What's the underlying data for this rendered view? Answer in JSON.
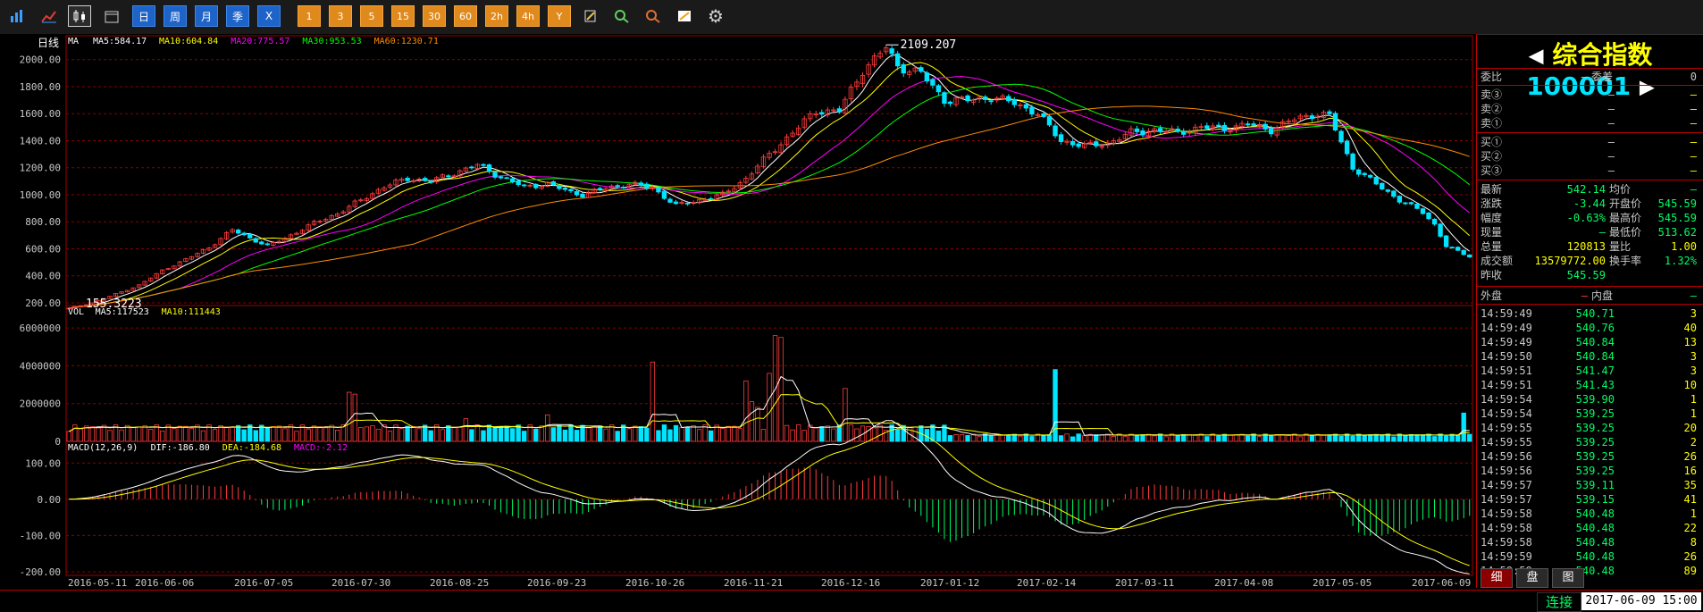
{
  "toolbar": {
    "buttons": [
      {
        "name": "bar-chart-icon",
        "text": "",
        "style": "icon"
      },
      {
        "name": "line-chart-icon",
        "text": "",
        "style": "icon"
      },
      {
        "name": "candlestick-icon",
        "text": "",
        "style": "active"
      },
      {
        "name": "calendar-icon",
        "text": "",
        "style": "icon"
      },
      {
        "name": "period-day-button",
        "text": "日",
        "style": "blue"
      },
      {
        "name": "period-week-button",
        "text": "周",
        "style": "blue"
      },
      {
        "name": "period-month-button",
        "text": "月",
        "style": "blue"
      },
      {
        "name": "period-quarter-button",
        "text": "季",
        "style": "blue"
      },
      {
        "name": "period-year-button",
        "text": "X",
        "style": "blue"
      },
      {
        "name": "period-1min-button",
        "text": "1",
        "style": "orange"
      },
      {
        "name": "period-3min-button",
        "text": "3",
        "style": "orange"
      },
      {
        "name": "period-5min-button",
        "text": "5",
        "style": "orange"
      },
      {
        "name": "period-15min-button",
        "text": "15",
        "style": "orange"
      },
      {
        "name": "period-30min-button",
        "text": "30",
        "style": "orange"
      },
      {
        "name": "period-60min-button",
        "text": "60",
        "style": "orange"
      },
      {
        "name": "period-2h-button",
        "text": "2h",
        "style": "orange"
      },
      {
        "name": "period-4h-button",
        "text": "4h",
        "style": "orange"
      },
      {
        "name": "period-y-button",
        "text": "Y",
        "style": "orange"
      },
      {
        "name": "edit-icon",
        "text": "",
        "style": "icon"
      },
      {
        "name": "zoom-in-icon",
        "text": "",
        "style": "icon"
      },
      {
        "name": "zoom-out-icon",
        "text": "",
        "style": "icon"
      },
      {
        "name": "draw-line-icon",
        "text": "",
        "style": "icon"
      },
      {
        "name": "settings-gear-icon",
        "text": "⚙",
        "style": "icon"
      }
    ]
  },
  "chart": {
    "period_label": "日线",
    "ma_legend": {
      "prefix": "MA",
      "items": [
        {
          "text": "MA5:584.17",
          "color": "#ffffff"
        },
        {
          "text": "MA10:604.84",
          "color": "#ffff00"
        },
        {
          "text": "MA20:775.57",
          "color": "#ff00ff"
        },
        {
          "text": "MA30:953.53",
          "color": "#00ff00"
        },
        {
          "text": "MA60:1230.71",
          "color": "#ff8c00"
        }
      ]
    },
    "price_ticks": [
      "2000.00",
      "1800.00",
      "1600.00",
      "1400.00",
      "1200.00",
      "1000.00",
      "800.00",
      "600.00",
      "400.00",
      "200.00"
    ],
    "high_label": "2109.207",
    "low_label": "155.3223",
    "vol_legend": [
      {
        "text": "VOL",
        "color": "#ffffff"
      },
      {
        "text": "MA5:117523",
        "color": "#ffffff"
      },
      {
        "text": "MA10:111443",
        "color": "#ffff00"
      }
    ],
    "vol_ticks": [
      "6000000",
      "4000000",
      "2000000",
      "0"
    ],
    "macd_legend": [
      {
        "text": "MACD(12,26,9)",
        "color": "#ffffff"
      },
      {
        "text": "DIF:-186.80",
        "color": "#ffffff"
      },
      {
        "text": "DEA:-184.68",
        "color": "#ffff00"
      },
      {
        "text": "MACD:-2.12",
        "color": "#ff00ff"
      }
    ],
    "macd_ticks": [
      "100.00",
      "0.00",
      "-100.00",
      "-200.00"
    ],
    "dates": [
      "2016-05-11",
      "2016-06-06",
      "2016-07-05",
      "2016-07-30",
      "2016-08-25",
      "2016-09-23",
      "2016-10-26",
      "2016-11-21",
      "2016-12-16",
      "2017-01-12",
      "2017-02-14",
      "2017-03-11",
      "2017-04-08",
      "2017-05-05",
      "2017-06-09"
    ]
  },
  "chart_data": {
    "type": "candlestick",
    "close_anchors": [
      [
        0,
        160
      ],
      [
        4,
        200
      ],
      [
        8,
        265
      ],
      [
        12,
        330
      ],
      [
        16,
        440
      ],
      [
        20,
        520
      ],
      [
        24,
        610
      ],
      [
        28,
        740
      ],
      [
        30,
        700
      ],
      [
        34,
        620
      ],
      [
        38,
        700
      ],
      [
        42,
        790
      ],
      [
        46,
        860
      ],
      [
        50,
        960
      ],
      [
        54,
        1060
      ],
      [
        58,
        1120
      ],
      [
        62,
        1100
      ],
      [
        66,
        1160
      ],
      [
        70,
        1220
      ],
      [
        74,
        1130
      ],
      [
        78,
        1060
      ],
      [
        82,
        1080
      ],
      [
        86,
        1020
      ],
      [
        88,
        1000
      ],
      [
        92,
        1050
      ],
      [
        96,
        1080
      ],
      [
        100,
        1050
      ],
      [
        104,
        920
      ],
      [
        108,
        960
      ],
      [
        112,
        1000
      ],
      [
        116,
        1120
      ],
      [
        120,
        1300
      ],
      [
        124,
        1460
      ],
      [
        128,
        1620
      ],
      [
        132,
        1620
      ],
      [
        136,
        1920
      ],
      [
        140,
        2090
      ],
      [
        142,
        1950
      ],
      [
        146,
        1900
      ],
      [
        150,
        1700
      ],
      [
        154,
        1700
      ],
      [
        158,
        1720
      ],
      [
        162,
        1680
      ],
      [
        166,
        1600
      ],
      [
        170,
        1400
      ],
      [
        174,
        1360
      ],
      [
        178,
        1380
      ],
      [
        182,
        1460
      ],
      [
        186,
        1480
      ],
      [
        190,
        1460
      ],
      [
        194,
        1500
      ],
      [
        198,
        1490
      ],
      [
        202,
        1520
      ],
      [
        206,
        1480
      ],
      [
        210,
        1560
      ],
      [
        214,
        1600
      ],
      [
        216,
        1580
      ],
      [
        220,
        1200
      ],
      [
        224,
        1080
      ],
      [
        228,
        960
      ],
      [
        232,
        870
      ],
      [
        234,
        780
      ],
      [
        236,
        620
      ],
      [
        238,
        580
      ],
      [
        240,
        545
      ]
    ],
    "volume_spikes": [
      [
        48,
        2600000
      ],
      [
        49,
        2500000
      ],
      [
        68,
        1200000
      ],
      [
        82,
        1400000
      ],
      [
        100,
        4200000
      ],
      [
        116,
        3200000
      ],
      [
        117,
        2100000
      ],
      [
        118,
        1800000
      ],
      [
        120,
        3600000
      ],
      [
        121,
        5600000
      ],
      [
        122,
        5500000
      ],
      [
        133,
        2800000
      ],
      [
        169,
        3800000
      ],
      [
        239,
        1500000
      ]
    ],
    "volume_base": 700000
  },
  "quote": {
    "title": "综合指数",
    "code": "100001",
    "weibi_label": "委比",
    "weibi_val": "—",
    "weicha_label": "委差",
    "weicha_val": "0",
    "asks": [
      {
        "label": "卖③",
        "price": "—",
        "vol": "—"
      },
      {
        "label": "卖②",
        "price": "—",
        "vol": "—"
      },
      {
        "label": "卖①",
        "price": "—",
        "vol": "—"
      }
    ],
    "bids": [
      {
        "label": "买①",
        "price": "—",
        "vol": "—"
      },
      {
        "label": "买②",
        "price": "—",
        "vol": "—"
      },
      {
        "label": "买③",
        "price": "—",
        "vol": "—"
      }
    ],
    "stats": [
      {
        "l1": "最新",
        "v1": "542.14",
        "l2": "均价",
        "v2": "—"
      },
      {
        "l1": "涨跌",
        "v1": "-3.44",
        "l2": "开盘价",
        "v2": "545.59"
      },
      {
        "l1": "幅度",
        "v1": "-0.63%",
        "l2": "最高价",
        "v2": "545.59"
      },
      {
        "l1": "现量",
        "v1": "—",
        "l2": "最低价",
        "v2": "513.62"
      },
      {
        "l1": "总量",
        "v1": "120813",
        "l2": "量比",
        "v2": "1.00"
      },
      {
        "l1": "成交额",
        "v1": "13579772.00",
        "l2": "换手率",
        "v2": "1.32%"
      },
      {
        "l1": "昨收",
        "v1": "545.59",
        "l2": "",
        "v2": ""
      }
    ],
    "waipan_label": "外盘",
    "waipan_val": "—",
    "neipan_label": "内盘",
    "neipan_val": "—",
    "ticks": [
      [
        "14:59:49",
        "540.71",
        "3"
      ],
      [
        "14:59:49",
        "540.76",
        "40"
      ],
      [
        "14:59:49",
        "540.84",
        "13"
      ],
      [
        "14:59:50",
        "540.84",
        "3"
      ],
      [
        "14:59:51",
        "541.47",
        "3"
      ],
      [
        "14:59:51",
        "541.43",
        "10"
      ],
      [
        "14:59:54",
        "539.90",
        "1"
      ],
      [
        "14:59:54",
        "539.25",
        "1"
      ],
      [
        "14:59:55",
        "539.25",
        "20"
      ],
      [
        "14:59:55",
        "539.25",
        "2"
      ],
      [
        "14:59:56",
        "539.25",
        "26"
      ],
      [
        "14:59:56",
        "539.25",
        "16"
      ],
      [
        "14:59:57",
        "539.11",
        "35"
      ],
      [
        "14:59:57",
        "539.15",
        "41"
      ],
      [
        "14:59:58",
        "540.48",
        "1"
      ],
      [
        "14:59:58",
        "540.48",
        "22"
      ],
      [
        "14:59:58",
        "540.48",
        "8"
      ],
      [
        "14:59:59",
        "540.48",
        "26"
      ],
      [
        "14:59:59",
        "540.48",
        "89"
      ]
    ],
    "tabs": [
      "细",
      "盘",
      "图"
    ]
  },
  "status": {
    "connection": "连接",
    "datetime": "2017-06-09 15:00"
  }
}
